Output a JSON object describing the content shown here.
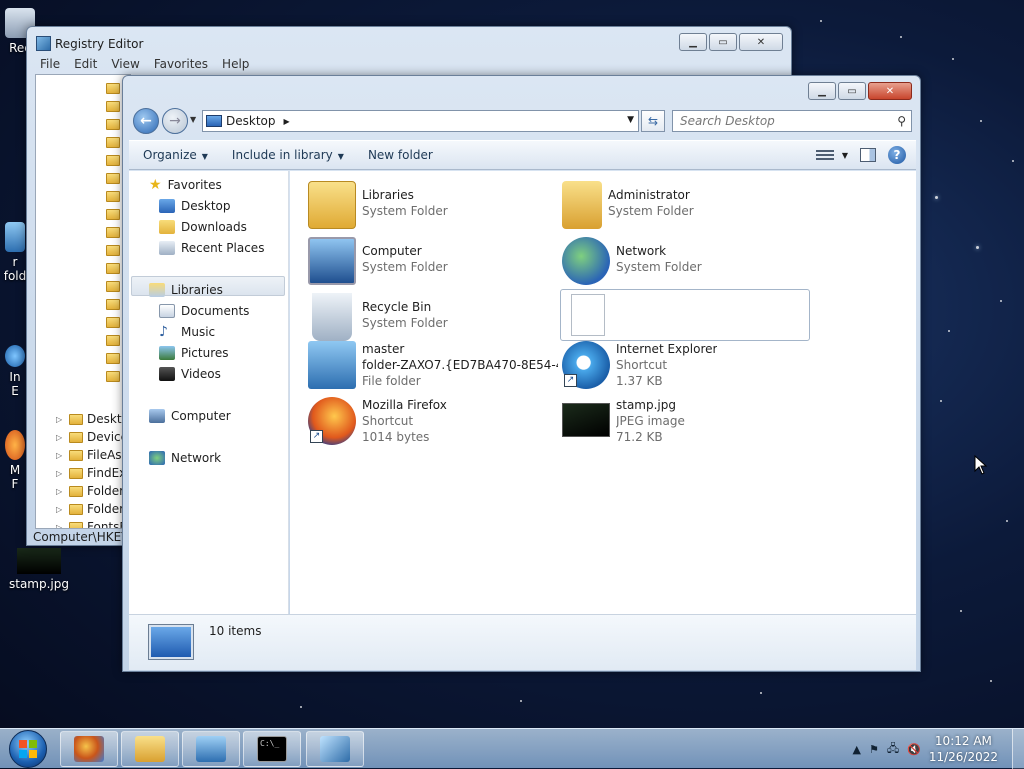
{
  "desktop": {
    "icons": [
      {
        "label": "Rec"
      },
      {
        "label": "r\nfold"
      },
      {
        "label": "In\nE"
      },
      {
        "label": "M\nF"
      },
      {
        "label": "stamp.jpg"
      }
    ]
  },
  "regedit": {
    "title": "Registry Editor",
    "menu": [
      "File",
      "Edit",
      "View",
      "Favorites",
      "Help"
    ],
    "tree_items": [
      "Deskto",
      "Device",
      "FileAss",
      "FindEx",
      "Folder",
      "Folder",
      "FontsF"
    ],
    "status": "Computer\\HKEY"
  },
  "explorer": {
    "address": "Desktop",
    "search_placeholder": "Search Desktop",
    "commands": {
      "organize": "Organize",
      "include": "Include in library",
      "new_folder": "New folder"
    },
    "nav": {
      "favorites": "Favorites",
      "favorites_items": [
        "Desktop",
        "Downloads",
        "Recent Places"
      ],
      "libraries": "Libraries",
      "libraries_items": [
        "Documents",
        "Music",
        "Pictures",
        "Videos"
      ],
      "computer": "Computer",
      "network": "Network"
    },
    "items": [
      {
        "name": "Libraries",
        "type": "System Folder",
        "icon": "libraries-icon"
      },
      {
        "name": "Administrator",
        "type": "System Folder",
        "icon": "user-folder-icon"
      },
      {
        "name": "Computer",
        "type": "System Folder",
        "icon": "computer-icon"
      },
      {
        "name": "Network",
        "type": "System Folder",
        "icon": "network-icon"
      },
      {
        "name": "Recycle Bin",
        "type": "System Folder",
        "icon": "recycle-bin-icon"
      },
      {
        "name": "",
        "type": "",
        "icon": "blank-file-icon"
      },
      {
        "name": "master",
        "name2": "folder-ZAXO7.{ED7BA470-8E54-4...",
        "type": "File folder",
        "icon": "folder-icon"
      },
      {
        "name": "Internet Explorer",
        "type": "Shortcut",
        "size": "1.37 KB",
        "icon": "internet-explorer-icon"
      },
      {
        "name": "Mozilla Firefox",
        "type": "Shortcut",
        "size": "1014 bytes",
        "icon": "firefox-icon"
      },
      {
        "name": "stamp.jpg",
        "type": "JPEG image",
        "size": "71.2 KB",
        "icon": "image-icon"
      }
    ],
    "item_count": "10 items"
  },
  "taskbar": {
    "time": "10:12 AM",
    "date": "11/26/2022"
  },
  "colors": {
    "accent": "#2c68b4",
    "window_frame": "#c3d4e8",
    "close_red": "#c8452d"
  }
}
